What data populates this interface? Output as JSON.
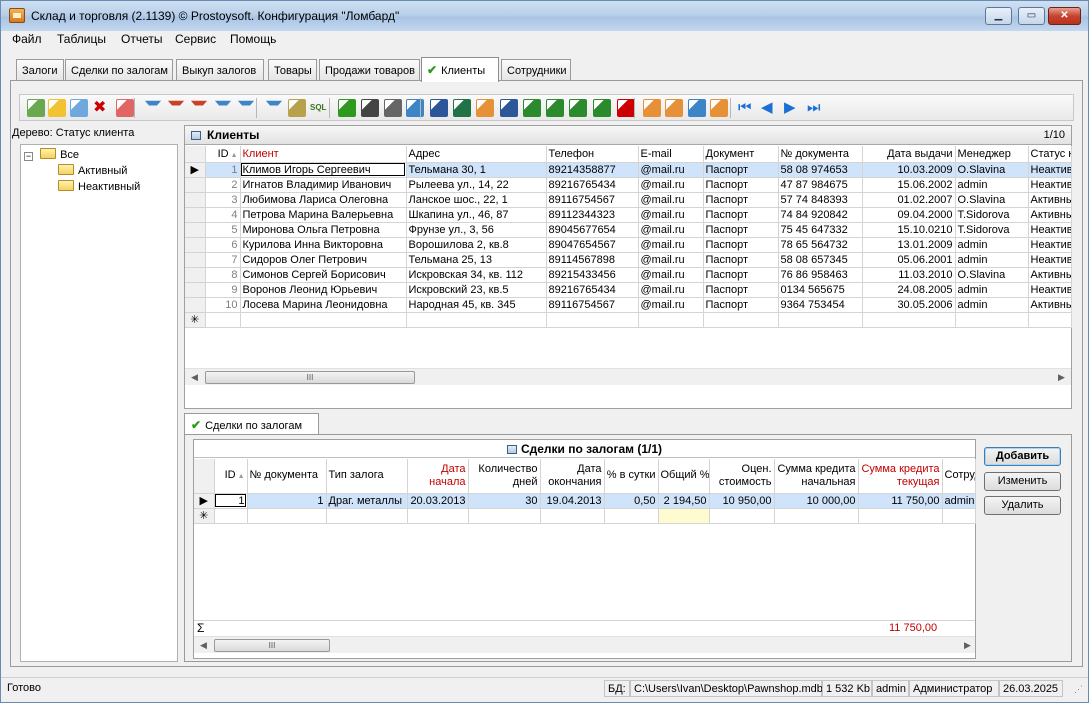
{
  "window": {
    "title": "Склад и торговля (2.1139) © Prostoysoft. Конфигурация \"Ломбард\""
  },
  "menu": [
    "Файл",
    "Таблицы",
    "Отчеты",
    "Сервис",
    "Помощь"
  ],
  "tabs": [
    "Залоги",
    "Сделки по залогам",
    "Выкуп залогов",
    "Товары",
    "Продажи товаров",
    "Клиенты",
    "Сотрудники"
  ],
  "active_tab": "Клиенты",
  "toolbar_icons": [
    "add-record-icon",
    "edit-icon",
    "copy-icon",
    "delete-icon",
    "delete-multiple-icon",
    "filter-icon",
    "filter-remove-icon",
    "filter-clear-icon",
    "filter-by-value-icon",
    "filter-advanced-icon",
    "filter-toggle-icon",
    "tree-view-icon",
    "sql-icon",
    "refresh-icon",
    "find-icon",
    "print-icon",
    "preview-icon",
    "export-word-icon",
    "export-excel-icon",
    "export-html-icon",
    "export-rtf-icon",
    "export-csv-icon",
    "export-txt-icon",
    "export-xml-icon",
    "export-dbf-icon",
    "chart-icon",
    "import-icon",
    "import-excel-icon",
    "columns-icon",
    "settings-icon",
    "first-record-icon",
    "prev-record-icon",
    "next-record-icon",
    "last-record-icon"
  ],
  "tree": {
    "header": "Дерево: Статус клиента",
    "root": "Все",
    "children": [
      "Активный",
      "Неактивный"
    ]
  },
  "clients": {
    "title": "Клиенты",
    "page": "1/10",
    "columns": [
      "ID",
      "Клиент",
      "Адрес",
      "Телефон",
      "E-mail",
      "Документ",
      "№ документа",
      "Дата выдачи",
      "Менеджер",
      "Статус к"
    ],
    "rows": [
      [
        "1",
        "Климов Игорь Сергеевич",
        "Тельмана 30, 1",
        "89214358877",
        "@mail.ru",
        "Паспорт",
        "58 08 974653",
        "10.03.2009",
        "O.Slavina",
        "Неактив"
      ],
      [
        "2",
        "Игнатов Владимир Иванович",
        "Рылеева ул., 14, 22",
        "89216765434",
        "@mail.ru",
        "Паспорт",
        "47 87 984675",
        "15.06.2002",
        "admin",
        "Неактив"
      ],
      [
        "3",
        "Любимова Лариса Олеговна",
        "Ланское шос., 22, 1",
        "89116754567",
        "@mail.ru",
        "Паспорт",
        "57 74 848393",
        "01.02.2007",
        "O.Slavina",
        "Активны"
      ],
      [
        "4",
        "Петрова Марина Валерьевна",
        "Шкапина ул., 46, 87",
        "89112344323",
        "@mail.ru",
        "Паспорт",
        "74 84 920842",
        "09.04.2000",
        "T.Sidorova",
        "Активны"
      ],
      [
        "5",
        "Миронова Ольга Петровна",
        "Фрунзе ул., 3, 56",
        "89045677654",
        "@mail.ru",
        "Паспорт",
        "75 45 647332",
        "15.10.0210",
        "T.Sidorova",
        "Неактив"
      ],
      [
        "6",
        "Курилова Инна Викторовна",
        "Ворошилова 2, кв.8",
        "89047654567",
        "@mail.ru",
        "Паспорт",
        "78 65 564732",
        "13.01.2009",
        "admin",
        "Неактив"
      ],
      [
        "7",
        "Сидоров Олег Петрович",
        "Тельмана 25,  13",
        "89114567898",
        "@mail.ru",
        "Паспорт",
        "58 08 657345",
        "05.06.2001",
        "admin",
        "Неактив"
      ],
      [
        "8",
        "Симонов Сергей Борисович",
        "Искровская 34, кв. 112",
        "89215433456",
        "@mail.ru",
        "Паспорт",
        "76 86 958463",
        "11.03.2010",
        "O.Slavina",
        "Активны"
      ],
      [
        "9",
        "Воронов Леонид Юрьевич",
        "Искровский 23, кв.5",
        "89216765434",
        "@mail.ru",
        "Паспорт",
        "0134 565675",
        "24.08.2005",
        "admin",
        "Неактив"
      ],
      [
        "10",
        "Лосева Марина Леонидовна",
        "Народная 45, кв. 345",
        "89116754567",
        "@mail.ru",
        "Паспорт",
        "9364 753454",
        "30.05.2006",
        "admin",
        "Активны"
      ]
    ]
  },
  "deals": {
    "tab_label": "Сделки по залогам",
    "title": "Сделки по залогам (1/1)",
    "columns": [
      {
        "l1": "ID",
        "l2": ""
      },
      {
        "l1": "№ документа",
        "l2": ""
      },
      {
        "l1": "Тип залога",
        "l2": ""
      },
      {
        "l1": "Дата",
        "l2": "начала"
      },
      {
        "l1": "Количество",
        "l2": "дней"
      },
      {
        "l1": "Дата",
        "l2": "окончания"
      },
      {
        "l1": "% в сутки",
        "l2": ""
      },
      {
        "l1": "Общий %",
        "l2": ""
      },
      {
        "l1": "Оцен.",
        "l2": "стоимость"
      },
      {
        "l1": "Сумма кредита",
        "l2": "начальная"
      },
      {
        "l1": "Сумма кредита",
        "l2": "текущая"
      },
      {
        "l1": "Сотруд",
        "l2": ""
      }
    ],
    "row": [
      "1",
      "1",
      "Драг. металлы",
      "20.03.2013",
      "30",
      "19.04.2013",
      "0,50",
      "2 194,50",
      "10 950,00",
      "10 000,00",
      "11 750,00",
      "admin"
    ],
    "total_current": "11 750,00",
    "sigma": "Σ",
    "buttons": {
      "add": "Добавить",
      "edit": "Изменить",
      "delete": "Удалить"
    }
  },
  "status": {
    "ready": "Готово",
    "db_label": "БД:",
    "db_path": "C:\\Users\\Ivan\\Desktop\\Pawnshop.mdb",
    "db_size": "1 532 Kb",
    "user": "admin",
    "role": "Администратор",
    "date": "26.03.2025"
  },
  "colors": {
    "selection": "#cfe3fb",
    "highlight_red": "#c00000",
    "check_green": "#2e9a1d"
  }
}
